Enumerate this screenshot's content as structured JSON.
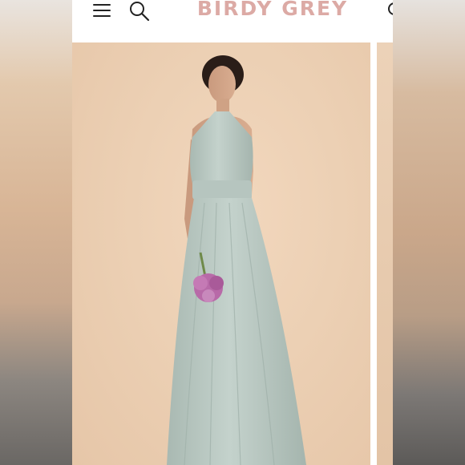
{
  "header": {
    "brand": "BIRDY GREY",
    "icons": [
      "menu-icon",
      "search-icon",
      "account-icon"
    ]
  },
  "product_image": {
    "dress_color": "#b9c8c2",
    "backdrop_color": "#ecd0b4",
    "flower_color": "#b86aa8"
  },
  "colors": {
    "brand": "#dcaaa5"
  }
}
